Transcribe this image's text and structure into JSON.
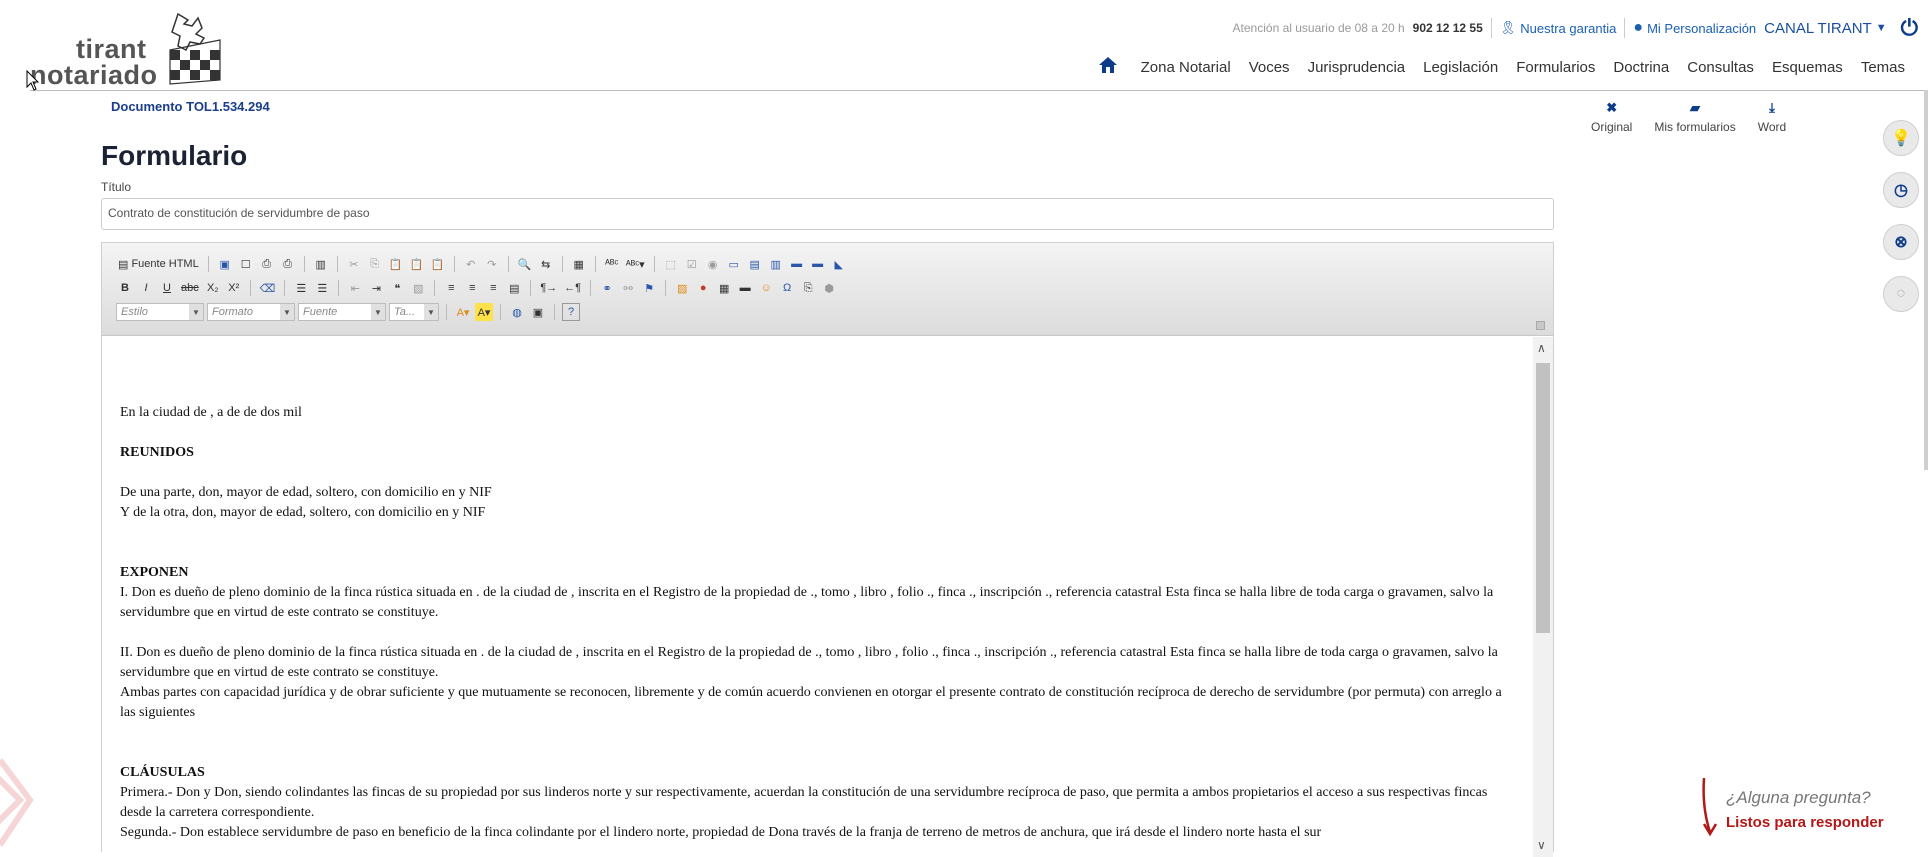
{
  "header": {
    "logo_line1": "tirant",
    "logo_line2": "notariado",
    "attention": "Atención al usuario de 08 a 20 h",
    "phone": "902 12 12 55",
    "guarantee": "Nuestra garantia",
    "personalization": "Mi Personalización",
    "canal": "CANAL TIRANT",
    "nav": [
      "Zona Notarial",
      "Voces",
      "Jurisprudencia",
      "Legislación",
      "Formularios",
      "Doctrina",
      "Consultas",
      "Esquemas",
      "Temas"
    ]
  },
  "document": {
    "ref": "Documento TOL1.534.294",
    "heading": "Formulario",
    "title_label": "Título",
    "title_value": "Contrato de constitución de servidumbre de paso"
  },
  "actions": [
    "Original",
    "Mis formularios",
    "Word"
  ],
  "toolbar": {
    "source_label": "Fuente HTML",
    "combos": [
      "Estilo",
      "Formato",
      "Fuente",
      "Ta..."
    ]
  },
  "content": {
    "p1": "En la ciudad de , a  de  de dos mil",
    "reunidos": "REUNIDOS",
    "p2": "De una parte, don, mayor de edad, soltero, con domicilio en y NIF",
    "p3": "Y de la otra, don, mayor de edad, soltero, con domicilio en y NIF",
    "exponen": "EXPONEN",
    "p4": "I. Don es dueño de pleno dominio de la finca rústica situada en . de la ciudad de , inscrita en el Registro de la propiedad de ., tomo , libro , folio ., finca ., inscripción ., referencia catastral Esta finca se halla libre de toda carga o gravamen, salvo la servidumbre que en virtud de este contrato se constituye.",
    "p5": "II. Don es dueño de pleno dominio de la finca rústica situada en . de la ciudad de , inscrita en el Registro de la propiedad de ., tomo , libro , folio ., finca ., inscripción ., referencia catastral Esta finca se halla libre de toda carga o gravamen, salvo la servidumbre que en virtud de este contrato se constituye.",
    "p6": "Ambas partes con capacidad jurídica y de obrar suficiente y que mutuamente se reconocen, libremente y de común acuerdo convienen en otorgar el presente contrato de constitución recíproca de derecho de servidumbre (por permuta) con arreglo a las siguientes",
    "clausulas": "CLÁUSULAS",
    "p7": "Primera.- Don  y Don, siendo colindantes las fincas de su propiedad por sus linderos norte y sur respectivamente, acuerdan la constitución de una servidumbre recíproca de paso, que permita a ambos propietarios el acceso a sus respectivas fincas desde la carretera correspondiente.",
    "p8": "Segunda.- Don establece servidumbre de paso en beneficio de la finca colindante por el lindero norte, propiedad de Dona través de la franja de terreno de  metros de anchura, que irá desde el lindero norte hasta el sur"
  },
  "chat": {
    "question": "¿Alguna pregunta?",
    "answer": "Listos para responder"
  }
}
